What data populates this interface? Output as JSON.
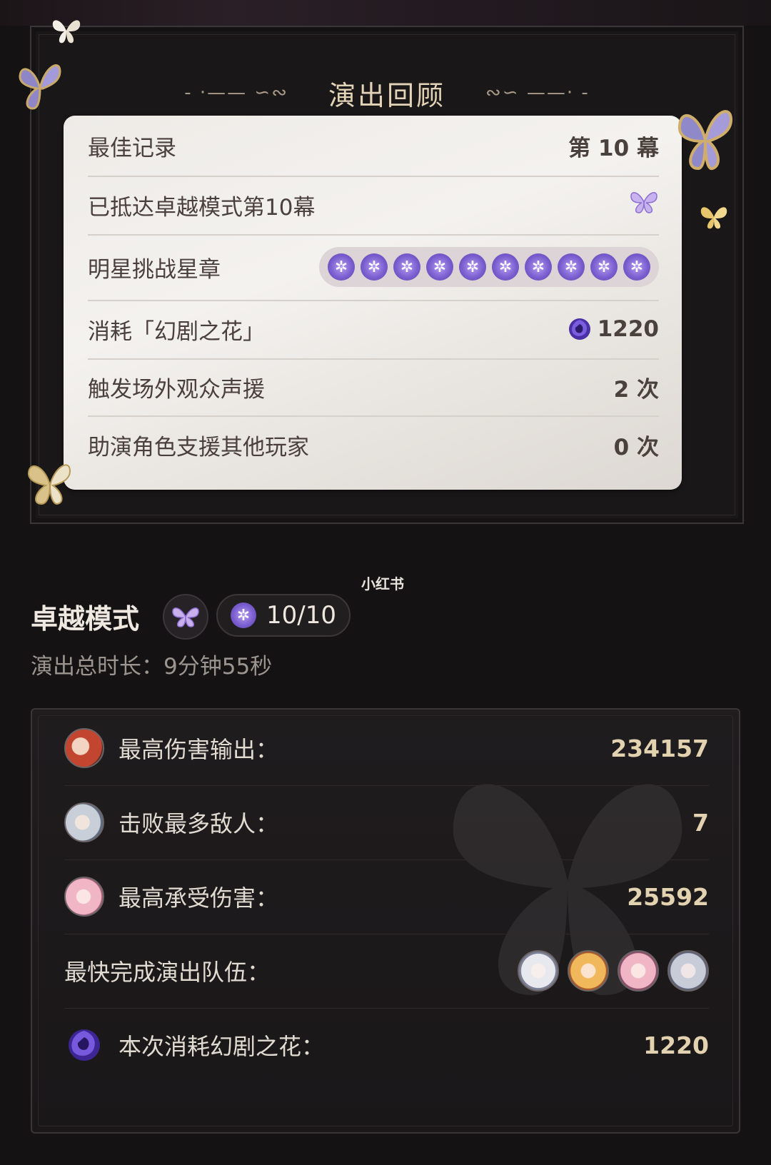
{
  "review": {
    "title": "演出回顾",
    "rows": [
      {
        "label": "最佳记录",
        "value": "第 10 幕"
      },
      {
        "label": "已抵达卓越模式第10幕",
        "value_icon": "purple-butterfly-icon"
      },
      {
        "label": "明星挑战星章",
        "badge_count": 10,
        "badge_icon": "star-medal-icon"
      },
      {
        "label": "消耗「幻剧之花」",
        "value": "1220",
        "value_icon": "flower-icon"
      },
      {
        "label": "触发场外观众声援",
        "value": "2 次"
      },
      {
        "label": "助演角色支援其他玩家",
        "value": "0 次"
      }
    ]
  },
  "watermark": "小红书",
  "mode": {
    "title": "卓越模式",
    "progress": "10/10",
    "duration": "演出总时长：9分钟55秒"
  },
  "stats": [
    {
      "label": "最高伤害输出：",
      "value": "234157",
      "avatar": "red-hair-character-avatar"
    },
    {
      "label": "击败最多敌人：",
      "value": "7",
      "avatar": "silver-hair-character-avatar"
    },
    {
      "label": "最高承受伤害：",
      "value": "25592",
      "avatar": "pink-hair-character-avatar"
    },
    {
      "label": "最快完成演出队伍：",
      "team": [
        "white-hair-avatar",
        "blonde-hair-avatar",
        "pink-hair-avatar",
        "silver-hair-avatar"
      ]
    },
    {
      "label": "本次消耗幻剧之花：",
      "value": "1220",
      "avatar": "flower-icon"
    }
  ],
  "colors": {
    "background": "#141213",
    "card": "#f0ede9",
    "gold_text": "#e3d2b0",
    "accent_purple": "#7c5fd0"
  }
}
